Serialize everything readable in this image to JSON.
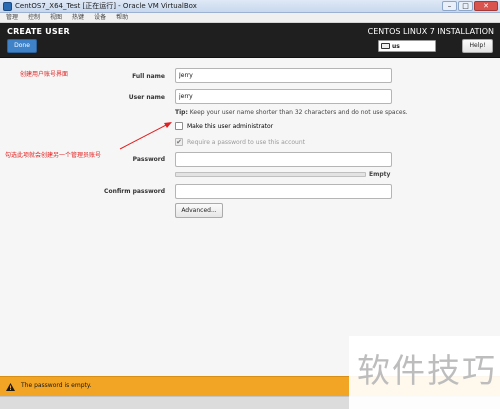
{
  "window": {
    "title": "CentOS7_X64_Test [正在运行] - Oracle VM VirtualBox",
    "minimize_glyph": "–",
    "maximize_glyph": "□",
    "close_glyph": "✕"
  },
  "menubar": {
    "items": [
      "管理",
      "控制",
      "视图",
      "热键",
      "设备",
      "帮助"
    ]
  },
  "header": {
    "page_title": "CREATE USER",
    "done_label": "Done",
    "install_title": "CENTOS LINUX 7 INSTALLATION",
    "keyboard_layout": "us",
    "help_label": "Help!",
    "background_color": "#1f1f1f",
    "done_color": "#3f82c8"
  },
  "form": {
    "full_name_label": "Full name",
    "full_name_value": "Jerry",
    "user_name_label": "User name",
    "user_name_value": "jerry",
    "tip_bold": "Tip:",
    "tip_text": " Keep your user name shorter than 32 characters and do not use spaces.",
    "admin_checkbox_label": "Make this user administrator",
    "require_password_checkbox_label": "Require a password to use this account",
    "require_password_mark": "✔",
    "password_label": "Password",
    "strength_label": "Empty",
    "confirm_password_label": "Confirm password",
    "advanced_label": "Advanced..."
  },
  "annotations": {
    "create_account_note": "创建用户账号界面",
    "admin_note": "勾选此项就会创建另一个管理员账号",
    "color": "#e02020"
  },
  "status": {
    "message": "The password is empty.",
    "warning_icon": "warning-icon",
    "background_color": "#f2a424"
  },
  "watermark": {
    "text": "软件技巧"
  }
}
